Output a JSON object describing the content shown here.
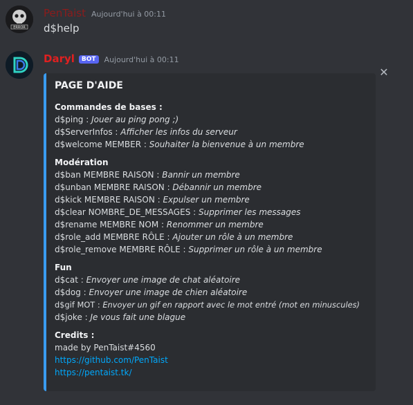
{
  "messages": [
    {
      "author": "PenTaist",
      "timestamp": "Aujourd'hui à 00:11",
      "content": "d$help",
      "avatar_icon": "skull-error-avatar"
    },
    {
      "author": "Daryl",
      "bot_tag": "BOT",
      "timestamp": "Aujourd'hui à 00:11",
      "avatar_icon": "d-logo-avatar"
    }
  ],
  "embed": {
    "accent_color": "#3a9cf0",
    "title": "PAGE D'AIDE",
    "sections": [
      {
        "heading": "Commandes de bases :",
        "items": [
          {
            "cmd": "d$ping : ",
            "desc": "Jouer au ping pong ;)"
          },
          {
            "cmd": "d$ServerInfos : ",
            "desc": "Afficher les infos du serveur"
          },
          {
            "cmd": "d$welcome MEMBER : ",
            "desc": "Souhaiter la bienvenue à un membre"
          }
        ]
      },
      {
        "heading": "Modération",
        "items": [
          {
            "cmd": "d$ban MEMBRE RAISON : ",
            "desc": "Bannir un membre"
          },
          {
            "cmd": "d$unban MEMBRE RAISON : ",
            "desc": "Débannir un membre"
          },
          {
            "cmd": "d$kick MEMBRE RAISON : ",
            "desc": "Expulser un membre"
          },
          {
            "cmd": "d$clear NOMBRE_DE_MESSAGES : ",
            "desc": "Supprimer les messages"
          },
          {
            "cmd": "d$rename MEMBRE NOM : ",
            "desc": "Renommer un membre"
          },
          {
            "cmd": "d$role_add MEMBRE RÔLE : ",
            "desc": "Ajouter un rôle à un membre"
          },
          {
            "cmd": "d$role_remove MEMBRE RÔLE : ",
            "desc": "Supprimer un rôle à un membre"
          }
        ]
      },
      {
        "heading": "Fun",
        "items": [
          {
            "cmd": "d$cat : ",
            "desc": "Envoyer une image de chat aléatoire"
          },
          {
            "cmd": "d$dog : ",
            "desc": "Envoyer une image de chien aléatoire"
          },
          {
            "cmd": "d$gif MOT : ",
            "desc": "Envoyer un gif en rapport avec le mot entré (mot en minuscules)"
          },
          {
            "cmd": "d$joke : ",
            "desc": "Je vous fait une blague"
          }
        ]
      }
    ],
    "credits": {
      "heading": "Credits :",
      "made_by": "made by PenTaist#4560",
      "links": [
        "https://github.com/PenTaist",
        "https://pentaist.tk/"
      ]
    },
    "close_glyph": "✕"
  }
}
